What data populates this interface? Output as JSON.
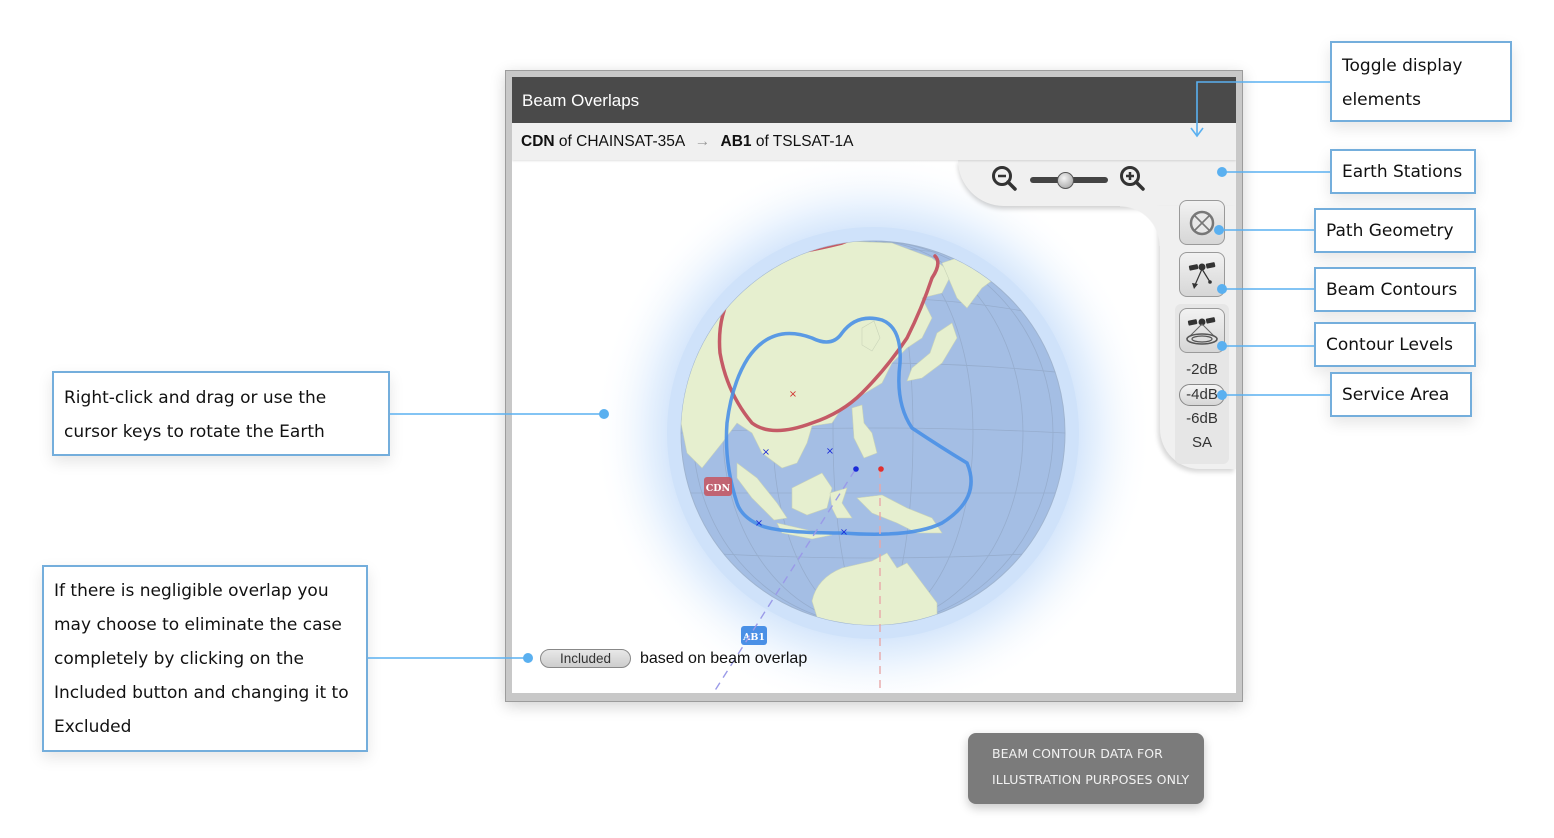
{
  "window": {
    "title": "Beam Overlaps",
    "subheader": {
      "beam_a": "CDN",
      "of_a": "of CHAINSAT-35A",
      "arrow": "→",
      "beam_b": "AB1",
      "of_b": "of TSLSAT-1A"
    },
    "zoom": {
      "zoom_out_icon": "zoom-out-icon",
      "zoom_in_icon": "zoom-in-icon",
      "level_percent": 50
    },
    "tools": {
      "earth_stations_icon": "earth-station-icon",
      "path_geometry_icon": "satellite-path-icon",
      "beam_contours_icon": "satellite-beam-icon",
      "contour_levels": [
        "-2dB",
        "-4dB",
        "-6dB"
      ],
      "selected_level": "-4dB",
      "service_area": "SA"
    },
    "globe": {
      "beam_labels": {
        "red": "CDN",
        "blue": "AB1"
      },
      "colors": {
        "ocean": "#a4bee4",
        "land": "#e6efcf",
        "red_contour": "#c45a66",
        "blue_contour": "#4a90e6",
        "halo": "#cfe2fa"
      }
    },
    "included": {
      "button_label": "Included",
      "text": "based on beam overlap"
    }
  },
  "annotations": {
    "toggle": "Toggle display elements",
    "earth_stations": "Earth Stations",
    "path_geometry": "Path Geometry",
    "beam_contours": "Beam Contours",
    "contour_levels": "Contour Levels",
    "service_area": "Service Area",
    "rotate": "Right-click and drag or use the cursor keys to rotate the Earth",
    "included": "If there is negligible overlap you may choose to eliminate the case completely by clicking on the Included button and changing it to Excluded",
    "accent": "#5ab0f0"
  },
  "note": {
    "line1": "BEAM CONTOUR DATA FOR",
    "line2": "ILLUSTRATION PURPOSES ONLY"
  }
}
